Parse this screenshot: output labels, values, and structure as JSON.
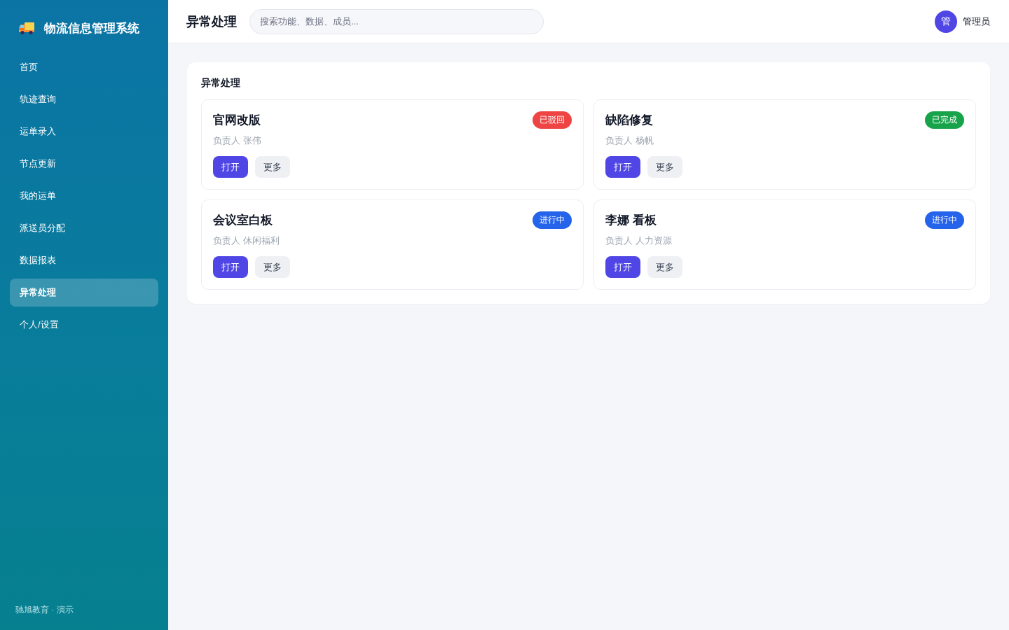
{
  "sidebar": {
    "logo_text": "物流信息管理系统",
    "items": [
      {
        "label": "首页",
        "selected": false
      },
      {
        "label": "轨迹查询",
        "selected": false
      },
      {
        "label": "运单录入",
        "selected": false
      },
      {
        "label": "节点更新",
        "selected": false
      },
      {
        "label": "我的运单",
        "selected": false
      },
      {
        "label": "派送员分配",
        "selected": false
      },
      {
        "label": "数据报表",
        "selected": false
      },
      {
        "label": "异常处理",
        "selected": true
      },
      {
        "label": "个人/设置",
        "selected": false
      }
    ],
    "footer": "驰旭教育 · 演示"
  },
  "header": {
    "title": "异常处理",
    "search": {
      "placeholder": "搜索功能、数据、成员..."
    },
    "user": {
      "avatar": "管",
      "name": "管理员"
    }
  },
  "panel": {
    "title": "异常处理",
    "cards": [
      {
        "title": "官网改版",
        "status": {
          "label": "已驳回",
          "color": "#ef4444"
        },
        "owner": "负责人 张伟",
        "buttons": [
          {
            "label": "打开",
            "kind": "primary"
          },
          {
            "label": "更多",
            "kind": "secondary"
          }
        ]
      },
      {
        "title": "缺陷修复",
        "status": {
          "label": "已完成",
          "color": "#16a34a"
        },
        "owner": "负责人 杨帆",
        "buttons": [
          {
            "label": "打开",
            "kind": "primary"
          },
          {
            "label": "更多",
            "kind": "secondary"
          }
        ]
      },
      {
        "title": "会议室白板",
        "status": {
          "label": "进行中",
          "color": "#2563eb"
        },
        "owner": "负责人 休闲福利",
        "buttons": [
          {
            "label": "打开",
            "kind": "primary"
          },
          {
            "label": "更多",
            "kind": "secondary"
          }
        ]
      },
      {
        "title": "李娜 看板",
        "status": {
          "label": "进行中",
          "color": "#2563eb"
        },
        "owner": "负责人 人力资源",
        "buttons": [
          {
            "label": "打开",
            "kind": "primary"
          },
          {
            "label": "更多",
            "kind": "secondary"
          }
        ]
      }
    ]
  }
}
